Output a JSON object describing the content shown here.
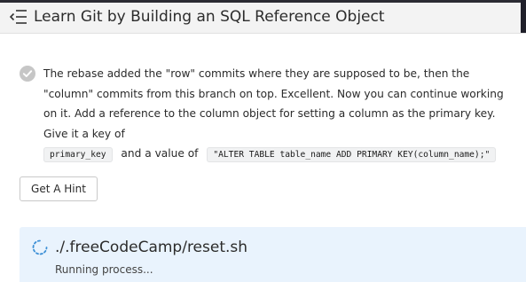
{
  "header": {
    "title": "Learn Git by Building an SQL Reference Object",
    "menu_icon": "menu-collapse-icon"
  },
  "step": {
    "status_icon": "check-circle-icon",
    "text_before_key": "The rebase added the \"row\" commits where they are supposed to be, then the \"column\" commits from this branch on top. Excellent. Now you can continue working on it. Add a reference to the column object for setting a column as the primary key. Give it a key of",
    "key_code": "primary_key",
    "text_between": "and a value of",
    "value_code": "\"ALTER TABLE table_name ADD PRIMARY KEY(column_name);\""
  },
  "hint_button": {
    "label": "Get A Hint"
  },
  "process": {
    "icon": "spinner-icon",
    "command": "./.freeCodeCamp/reset.sh",
    "status": "Running process..."
  },
  "colors": {
    "header_bg": "#f3f3f3",
    "panel_bg": "#e9f3fd",
    "check_gray": "#c6c6c6",
    "spinner_blue": "#3b8fd6"
  }
}
